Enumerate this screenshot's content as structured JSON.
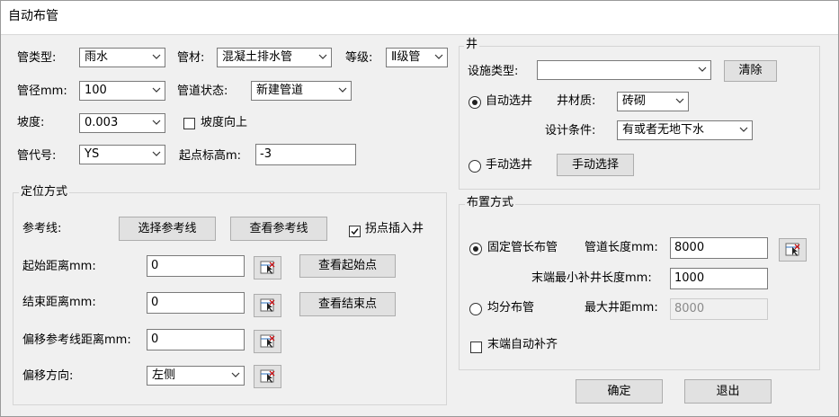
{
  "window": {
    "title": "自动布管"
  },
  "pipe": {
    "type_label": "管类型:",
    "type_value": "雨水",
    "material_label": "管材:",
    "material_value": "混凝土排水管",
    "grade_label": "等级:",
    "grade_value": "Ⅱ级管",
    "diameter_label": "管径mm:",
    "diameter_value": "100",
    "status_label": "管道状态:",
    "status_value": "新建管道",
    "slope_label": "坡度:",
    "slope_value": "0.003",
    "slope_up_label": "坡度向上",
    "slope_up_checked": false,
    "code_label": "管代号:",
    "code_value": "YS",
    "start_elev_label": "起点标高m:",
    "start_elev_value": "-3"
  },
  "positioning": {
    "group_label": "定位方式",
    "ref_line_label": "参考线:",
    "select_ref_button": "选择参考线",
    "view_ref_button": "查看参考线",
    "insert_well_label": "拐点插入井",
    "insert_well_checked": true,
    "start_dist_label": "起始距离mm:",
    "start_dist_value": "0",
    "view_start_button": "查看起始点",
    "end_dist_label": "结束距离mm:",
    "end_dist_value": "0",
    "view_end_button": "查看结束点",
    "offset_dist_label": "偏移参考线距离mm:",
    "offset_dist_value": "0",
    "offset_dir_label": "偏移方向:",
    "offset_dir_value": "左侧"
  },
  "well": {
    "group_label": "井",
    "facility_type_label": "设施类型:",
    "facility_type_value": "",
    "clear_button": "清除",
    "auto_select_label": "自动选井",
    "auto_select_checked": true,
    "material_label": "井材质:",
    "material_value": "砖砌",
    "design_cond_label": "设计条件:",
    "design_cond_value": "有或者无地下水",
    "manual_select_label": "手动选井",
    "manual_select_checked": false,
    "manual_select_button": "手动选择"
  },
  "layout": {
    "group_label": "布置方式",
    "fixed_length_label": "固定管长布管",
    "fixed_length_checked": true,
    "pipe_length_label": "管道长度mm:",
    "pipe_length_value": "8000",
    "min_well_len_label": "末端最小补井长度mm:",
    "min_well_len_value": "1000",
    "even_label": "均分布管",
    "even_checked": false,
    "max_spacing_label": "最大井距mm:",
    "max_spacing_value": "8000",
    "auto_fill_label": "末端自动补齐",
    "auto_fill_checked": false
  },
  "footer": {
    "ok_button": "确定",
    "cancel_button": "退出"
  },
  "icons": {
    "dropdown": "chevron-down-icon",
    "pick": "pick-point-icon"
  }
}
